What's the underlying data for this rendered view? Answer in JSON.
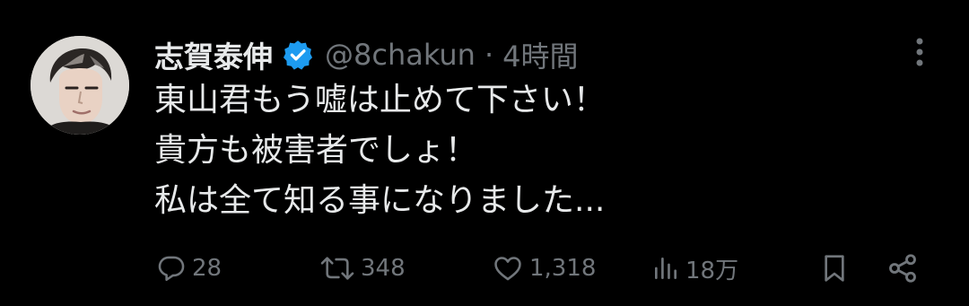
{
  "tweet": {
    "display_name": "志賀泰伸",
    "handle": "@8chakun",
    "separator": "·",
    "time": "4時間",
    "verified_color": "#1d9bf0",
    "text_lines": [
      "東山君もう嘘は止めて下さい！",
      "貴方も被害者でしょ！",
      "私は全て知る事になりました..."
    ],
    "actions": {
      "reply_count": "28",
      "retweet_count": "348",
      "like_count": "1,318",
      "views_count": "18万"
    },
    "icons": {
      "reply": "reply-icon",
      "retweet": "retweet-icon",
      "like": "heart-icon",
      "views": "views-icon",
      "bookmark": "bookmark-icon",
      "share": "share-icon",
      "more": "more-vertical-icon",
      "verified": "verified-badge-icon"
    },
    "colors": {
      "background": "#000000",
      "text": "#e7e9ea",
      "secondary": "#71767b"
    }
  }
}
